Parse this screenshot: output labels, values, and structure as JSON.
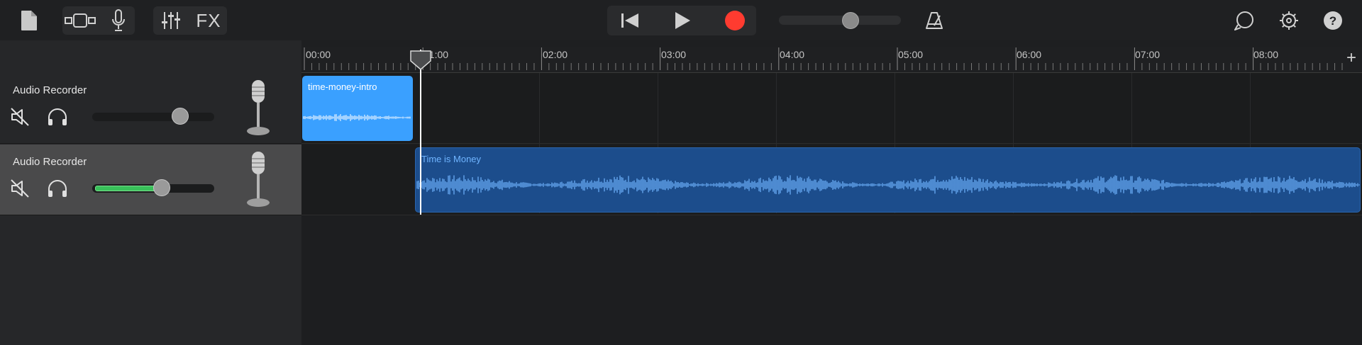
{
  "toolbar": {
    "fx_label": "FX"
  },
  "colors": {
    "record": "#ff3b30",
    "region_intro": "#3aa0ff",
    "region_main": "#1c4d8c",
    "waveform": "#6fb4ff",
    "level": "#39c15a"
  },
  "ruler": {
    "labels": [
      "00:00",
      "01:00",
      "02:00",
      "03:00",
      "04:00",
      "05:00",
      "06:00",
      "07:00",
      "08:00"
    ],
    "add_label": "+"
  },
  "tracks": [
    {
      "name": "Audio Recorder",
      "volume": 0.76,
      "level": 0.0,
      "selected": false
    },
    {
      "name": "Audio Recorder",
      "volume": 0.58,
      "level": 0.55,
      "selected": true
    }
  ],
  "regions": [
    {
      "name": "time-money-intro"
    },
    {
      "name": "Time is Money"
    }
  ],
  "master_volume": 0.6
}
